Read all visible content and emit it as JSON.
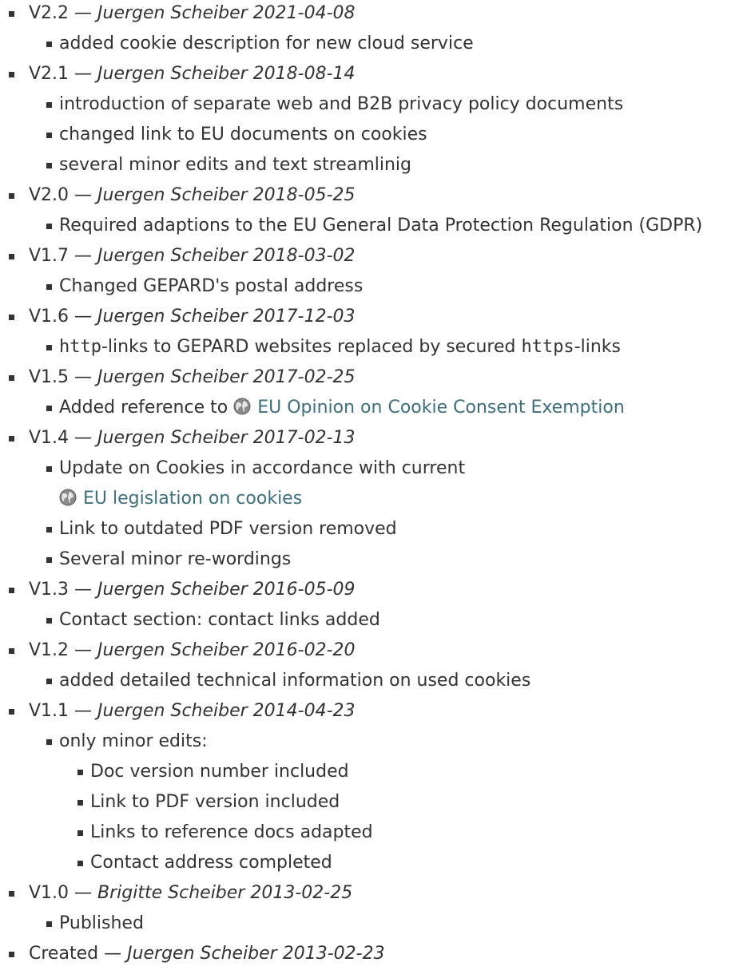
{
  "entries": [
    {
      "version": "V2.2",
      "author_date": "Juergen Scheiber 2021-04-08",
      "items": [
        {
          "text": "added cookie description for new cloud service"
        }
      ]
    },
    {
      "version": "V2.1",
      "author_date": "Juergen Scheiber 2018-08-14",
      "items": [
        {
          "text": "introduction of separate web and B2B privacy policy documents"
        },
        {
          "text": "changed link to EU documents on cookies"
        },
        {
          "text": "several minor edits and text streamlinig"
        }
      ]
    },
    {
      "version": "V2.0",
      "author_date": "Juergen Scheiber 2018-05-25",
      "items": [
        {
          "text": "Required adaptions to the EU General Data Protection Regulation (GDPR)"
        }
      ]
    },
    {
      "version": "V1.7",
      "author_date": "Juergen Scheiber 2018-03-02",
      "items": [
        {
          "text": "Changed GEPARD's postal address"
        }
      ]
    },
    {
      "version": "V1.6",
      "author_date": "Juergen Scheiber 2017-12-03",
      "items": [
        {
          "code1": "http",
          "mid": "-links to GEPARD websites replaced by secured ",
          "code2": "https",
          "end": "-links"
        }
      ]
    },
    {
      "version": "V1.5",
      "author_date": "Juergen Scheiber 2017-02-25",
      "items": [
        {
          "text": "Added reference to ",
          "link": "EU Opinion on Cookie Consent Exemption"
        }
      ]
    },
    {
      "version": "V1.4",
      "author_date": "Juergen Scheiber 2017-02-13",
      "items": [
        {
          "text": "Update on Cookies in accordance with current",
          "link2": "EU legislation on cookies"
        },
        {
          "text": "Link to outdated PDF version removed"
        },
        {
          "text": "Several minor re-wordings"
        }
      ]
    },
    {
      "version": "V1.3",
      "author_date": "Juergen Scheiber 2016-05-09",
      "items": [
        {
          "text": "Contact section: contact links added"
        }
      ]
    },
    {
      "version": "V1.2",
      "author_date": "Juergen Scheiber 2016-02-20",
      "items": [
        {
          "text": "added detailed technical information on used cookies"
        }
      ]
    },
    {
      "version": "V1.1",
      "author_date": "Juergen Scheiber 2014-04-23",
      "items": [
        {
          "text": "only minor edits:",
          "sub": [
            "Doc version number included",
            "Link to PDF version included",
            "Links to reference docs adapted",
            "Contact address completed"
          ]
        }
      ]
    },
    {
      "version": "V1.0",
      "author_date": "Brigitte Scheiber 2013-02-25",
      "items": [
        {
          "text": "Published"
        }
      ]
    },
    {
      "version": "Created",
      "author_date": "Juergen Scheiber 2013-02-23",
      "items": []
    }
  ],
  "separator": " — ",
  "icons": {
    "link_icon": "globe-icon"
  },
  "colors": {
    "text": "#333333",
    "link": "#3d6f7d"
  }
}
